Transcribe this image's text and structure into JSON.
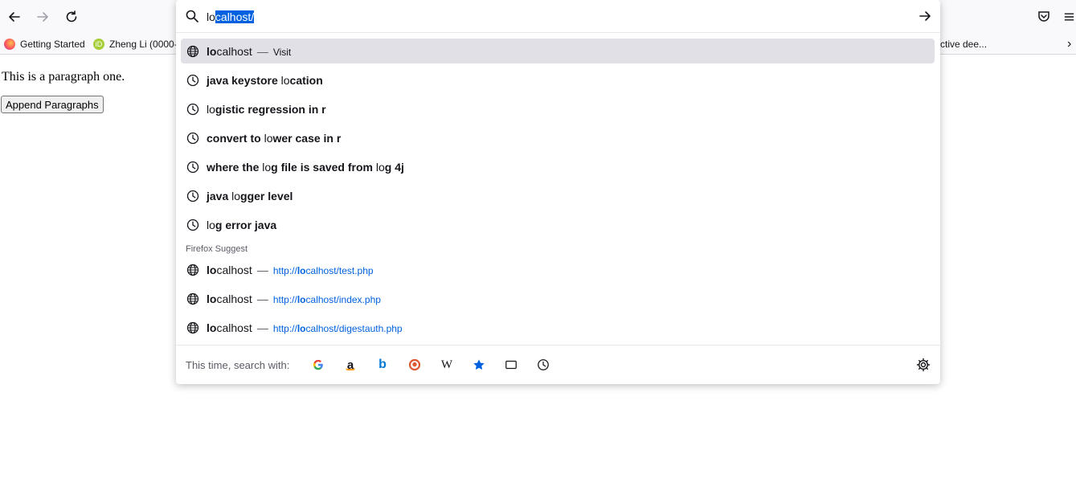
{
  "toolbar": {
    "back": "back-icon",
    "forward": "forward-icon",
    "reload": "reload-icon",
    "pocket": "pocket-icon",
    "menu": "menu-icon"
  },
  "bookmarks": [
    {
      "label": "Getting Started",
      "icon": "firefox-icon"
    },
    {
      "label": "Zheng Li (0000-",
      "icon": "orcid-icon"
    },
    {
      "label": "ctive dee...",
      "icon": ""
    }
  ],
  "page": {
    "paragraph": "This is a paragraph one.",
    "button_label": "Append Paragraphs"
  },
  "urlbar": {
    "typed": "lo",
    "autofill": "calhost/",
    "rows": [
      {
        "icon": "globe-icon",
        "bold": "lo",
        "text": "calhost",
        "action": "Visit",
        "highlighted": true
      },
      {
        "icon": "history-icon",
        "pre": "",
        "parts": [
          [
            "java keystore ",
            true
          ],
          [
            "lo",
            false
          ],
          [
            "cation",
            true
          ]
        ]
      },
      {
        "icon": "history-icon",
        "parts": [
          [
            "lo",
            false
          ],
          [
            "gistic regression in r",
            true
          ]
        ]
      },
      {
        "icon": "history-icon",
        "parts": [
          [
            "convert to ",
            true
          ],
          [
            "lo",
            false
          ],
          [
            "wer case in r",
            true
          ]
        ]
      },
      {
        "icon": "history-icon",
        "parts": [
          [
            "where the ",
            true
          ],
          [
            "lo",
            false
          ],
          [
            "g file is saved from ",
            true
          ],
          [
            "lo",
            false
          ],
          [
            "g 4j",
            true
          ]
        ]
      },
      {
        "icon": "history-icon",
        "parts": [
          [
            "java ",
            true
          ],
          [
            "lo",
            false
          ],
          [
            "gger level",
            true
          ]
        ]
      },
      {
        "icon": "history-icon",
        "parts": [
          [
            "lo",
            false
          ],
          [
            "g error java",
            true
          ]
        ]
      }
    ],
    "group_label": "Firefox Suggest",
    "suggest_rows": [
      {
        "title_bold": "lo",
        "title": "calhost",
        "url_pre": "http://",
        "url_bold": "lo",
        "url_post": "calhost/test.php"
      },
      {
        "title_bold": "lo",
        "title": "calhost",
        "url_pre": "http://",
        "url_bold": "lo",
        "url_post": "calhost/index.php"
      },
      {
        "title_bold": "lo",
        "title": "calhost",
        "url_pre": "http://",
        "url_bold": "lo",
        "url_post": "calhost/digestauth.php"
      }
    ],
    "footer_label": "This time, search with:",
    "engines": [
      "google-icon",
      "amazon-icon",
      "bing-icon",
      "duckduckgo-icon",
      "wikipedia-icon",
      "bookmarks-star-icon",
      "tabs-icon",
      "history-clock-icon"
    ],
    "settings": "settings-gear-icon"
  },
  "colors": {
    "accent": "#0061e0",
    "highlight_row": "#e0e0e6",
    "toolbar_bg": "#f9f9fb"
  }
}
